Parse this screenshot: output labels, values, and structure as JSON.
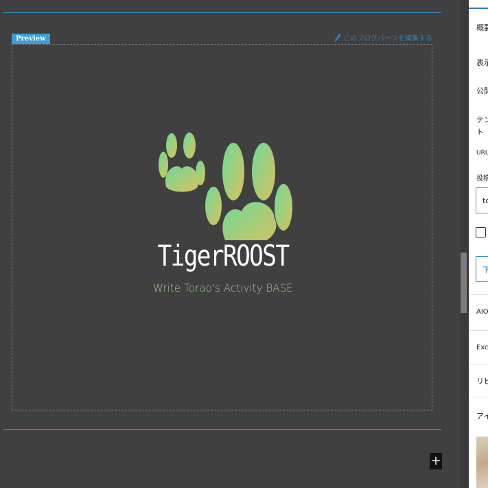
{
  "preview": {
    "badge": "Preview",
    "edit_link": "このブログパーツを編集する"
  },
  "logo": {
    "title": "TigerROOST",
    "tagline": "Write Torao's Activity BASE",
    "colors": {
      "green": "#6fd99a",
      "yellow": "#d6c25d",
      "title": "#ffffff",
      "tagline": "#9cc989"
    }
  },
  "toolbar": {
    "add_label": "+"
  },
  "sidebar": {
    "items": [
      "概要",
      "表示",
      "公開",
      "テン",
      "ト",
      "URL",
      "投稿",
      "AIOS",
      "Exce",
      "リビ",
      "アイ"
    ],
    "input_value": "to",
    "button_label": "下"
  },
  "colors": {
    "accent": "#2d9bd1",
    "background": "#404040"
  }
}
